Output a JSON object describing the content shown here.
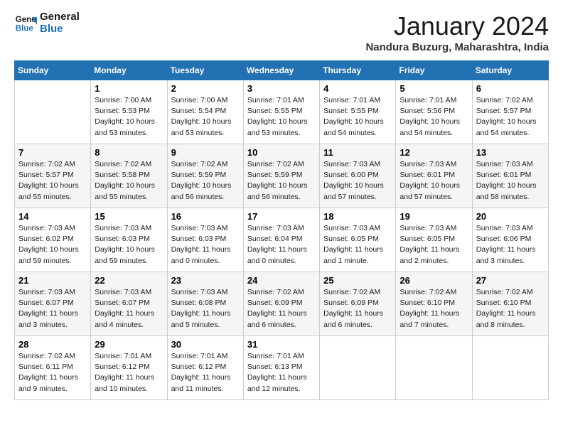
{
  "logo": {
    "line1": "General",
    "line2": "Blue"
  },
  "title": "January 2024",
  "location": "Nandura Buzurg, Maharashtra, India",
  "days_of_week": [
    "Sunday",
    "Monday",
    "Tuesday",
    "Wednesday",
    "Thursday",
    "Friday",
    "Saturday"
  ],
  "weeks": [
    [
      {
        "day": "",
        "info": ""
      },
      {
        "day": "1",
        "info": "Sunrise: 7:00 AM\nSunset: 5:53 PM\nDaylight: 10 hours\nand 53 minutes."
      },
      {
        "day": "2",
        "info": "Sunrise: 7:00 AM\nSunset: 5:54 PM\nDaylight: 10 hours\nand 53 minutes."
      },
      {
        "day": "3",
        "info": "Sunrise: 7:01 AM\nSunset: 5:55 PM\nDaylight: 10 hours\nand 53 minutes."
      },
      {
        "day": "4",
        "info": "Sunrise: 7:01 AM\nSunset: 5:55 PM\nDaylight: 10 hours\nand 54 minutes."
      },
      {
        "day": "5",
        "info": "Sunrise: 7:01 AM\nSunset: 5:56 PM\nDaylight: 10 hours\nand 54 minutes."
      },
      {
        "day": "6",
        "info": "Sunrise: 7:02 AM\nSunset: 5:57 PM\nDaylight: 10 hours\nand 54 minutes."
      }
    ],
    [
      {
        "day": "7",
        "info": "Sunrise: 7:02 AM\nSunset: 5:57 PM\nDaylight: 10 hours\nand 55 minutes."
      },
      {
        "day": "8",
        "info": "Sunrise: 7:02 AM\nSunset: 5:58 PM\nDaylight: 10 hours\nand 55 minutes."
      },
      {
        "day": "9",
        "info": "Sunrise: 7:02 AM\nSunset: 5:59 PM\nDaylight: 10 hours\nand 56 minutes."
      },
      {
        "day": "10",
        "info": "Sunrise: 7:02 AM\nSunset: 5:59 PM\nDaylight: 10 hours\nand 56 minutes."
      },
      {
        "day": "11",
        "info": "Sunrise: 7:03 AM\nSunset: 6:00 PM\nDaylight: 10 hours\nand 57 minutes."
      },
      {
        "day": "12",
        "info": "Sunrise: 7:03 AM\nSunset: 6:01 PM\nDaylight: 10 hours\nand 57 minutes."
      },
      {
        "day": "13",
        "info": "Sunrise: 7:03 AM\nSunset: 6:01 PM\nDaylight: 10 hours\nand 58 minutes."
      }
    ],
    [
      {
        "day": "14",
        "info": "Sunrise: 7:03 AM\nSunset: 6:02 PM\nDaylight: 10 hours\nand 59 minutes."
      },
      {
        "day": "15",
        "info": "Sunrise: 7:03 AM\nSunset: 6:03 PM\nDaylight: 10 hours\nand 59 minutes."
      },
      {
        "day": "16",
        "info": "Sunrise: 7:03 AM\nSunset: 6:03 PM\nDaylight: 11 hours\nand 0 minutes."
      },
      {
        "day": "17",
        "info": "Sunrise: 7:03 AM\nSunset: 6:04 PM\nDaylight: 11 hours\nand 0 minutes."
      },
      {
        "day": "18",
        "info": "Sunrise: 7:03 AM\nSunset: 6:05 PM\nDaylight: 11 hours\nand 1 minute."
      },
      {
        "day": "19",
        "info": "Sunrise: 7:03 AM\nSunset: 6:05 PM\nDaylight: 11 hours\nand 2 minutes."
      },
      {
        "day": "20",
        "info": "Sunrise: 7:03 AM\nSunset: 6:06 PM\nDaylight: 11 hours\nand 3 minutes."
      }
    ],
    [
      {
        "day": "21",
        "info": "Sunrise: 7:03 AM\nSunset: 6:07 PM\nDaylight: 11 hours\nand 3 minutes."
      },
      {
        "day": "22",
        "info": "Sunrise: 7:03 AM\nSunset: 6:07 PM\nDaylight: 11 hours\nand 4 minutes."
      },
      {
        "day": "23",
        "info": "Sunrise: 7:03 AM\nSunset: 6:08 PM\nDaylight: 11 hours\nand 5 minutes."
      },
      {
        "day": "24",
        "info": "Sunrise: 7:02 AM\nSunset: 6:09 PM\nDaylight: 11 hours\nand 6 minutes."
      },
      {
        "day": "25",
        "info": "Sunrise: 7:02 AM\nSunset: 6:09 PM\nDaylight: 11 hours\nand 6 minutes."
      },
      {
        "day": "26",
        "info": "Sunrise: 7:02 AM\nSunset: 6:10 PM\nDaylight: 11 hours\nand 7 minutes."
      },
      {
        "day": "27",
        "info": "Sunrise: 7:02 AM\nSunset: 6:10 PM\nDaylight: 11 hours\nand 8 minutes."
      }
    ],
    [
      {
        "day": "28",
        "info": "Sunrise: 7:02 AM\nSunset: 6:11 PM\nDaylight: 11 hours\nand 9 minutes."
      },
      {
        "day": "29",
        "info": "Sunrise: 7:01 AM\nSunset: 6:12 PM\nDaylight: 11 hours\nand 10 minutes."
      },
      {
        "day": "30",
        "info": "Sunrise: 7:01 AM\nSunset: 6:12 PM\nDaylight: 11 hours\nand 11 minutes."
      },
      {
        "day": "31",
        "info": "Sunrise: 7:01 AM\nSunset: 6:13 PM\nDaylight: 11 hours\nand 12 minutes."
      },
      {
        "day": "",
        "info": ""
      },
      {
        "day": "",
        "info": ""
      },
      {
        "day": "",
        "info": ""
      }
    ]
  ]
}
